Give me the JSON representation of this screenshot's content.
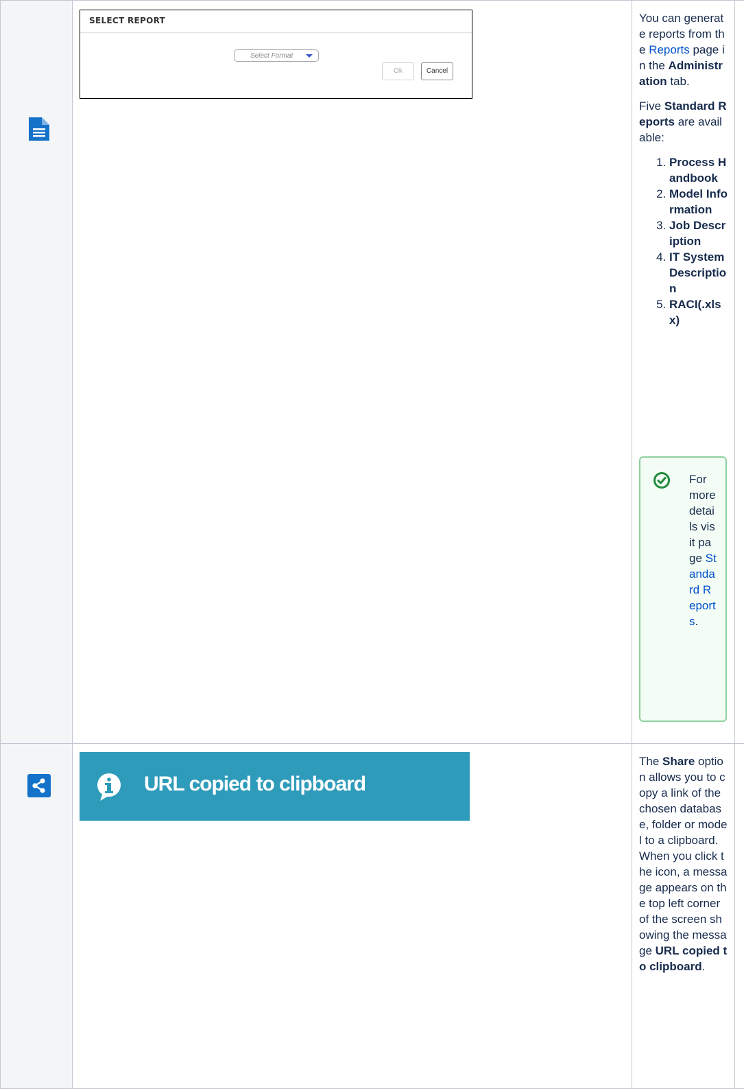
{
  "row1": {
    "icon": "document-icon",
    "dialog": {
      "title": "SELECT REPORT",
      "select_placeholder": "Select Format",
      "ok_label": "Ok",
      "cancel_label": "Cancel"
    },
    "description": {
      "p1_a": "You can generate reports from the ",
      "p1_link": "Reports",
      "p1_b": " page in the ",
      "p1_bold": "Administration",
      "p1_c": " tab.",
      "p2_a": "Five ",
      "p2_bold": "Standard Reports",
      "p2_b": " are available:",
      "reports": [
        "Process Handbook",
        "Model Information",
        "Job Description",
        "IT System Description",
        "RACI(.xlsx)"
      ]
    },
    "note": {
      "icon": "check-circle-icon",
      "text_a": "For more details visit page ",
      "link": "Standard Reports",
      "text_b": "."
    }
  },
  "row2": {
    "icon": "share-icon",
    "toast": {
      "icon": "info-icon",
      "message": "URL copied to clipboard"
    },
    "description": {
      "a": "The ",
      "bold1": "Share",
      "b": " option allows you to copy a link of the chosen database, folder or model to a clipboard. When you click the icon, a message appears on the top left corner of the screen showing the message ",
      "bold2": "URL copied to clipboard",
      "c": "."
    }
  },
  "colors": {
    "icon_blue": "#1473c9",
    "toast_bg": "#2f9bba",
    "link": "#0052cc",
    "note_border": "#8fd19e",
    "note_icon": "#1f8a3c"
  }
}
